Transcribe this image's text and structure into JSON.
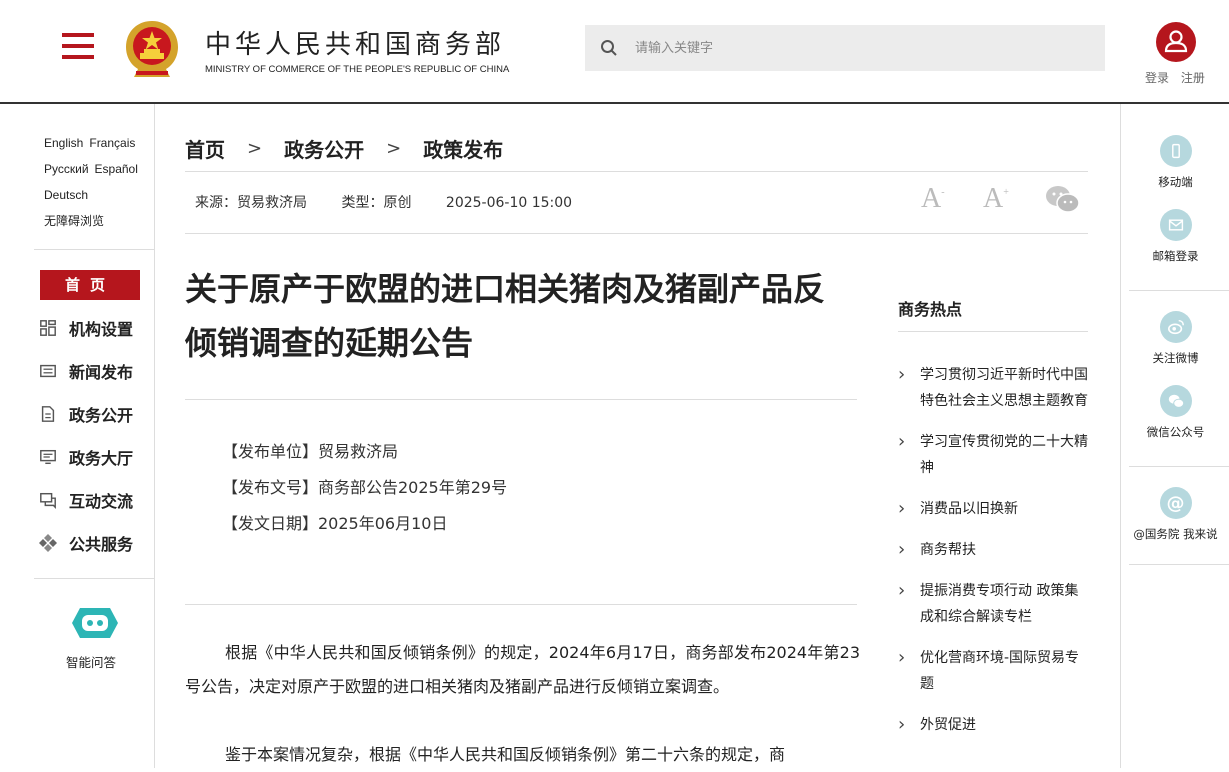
{
  "header": {
    "title": "中华人民共和国商务部",
    "subtitle": "MINISTRY OF COMMERCE OF THE PEOPLE'S REPUBLIC OF CHINA",
    "search_placeholder": "请输入关键字",
    "login": "登录",
    "register": "注册"
  },
  "languages": {
    "english": "English",
    "french": "Français",
    "russian": "Русский",
    "spanish": "Español",
    "german": "Deutsch",
    "accessibility": "无障碍浏览"
  },
  "nav": {
    "home": "首页",
    "items": [
      "机构设置",
      "新闻发布",
      "政务公开",
      "政务大厅",
      "互动交流",
      "公共服务"
    ],
    "robot_label": "智能问答"
  },
  "breadcrumb": [
    "首页",
    "政务公开",
    "政策发布"
  ],
  "meta": {
    "source": "来源：贸易救济局",
    "type": "类型：原创",
    "date": "2025-06-10 15:00"
  },
  "font_controls": [
    "A",
    "A"
  ],
  "article": {
    "title": "关于原产于欧盟的进口相关猪肉及猪副产品反倾销调查的延期公告",
    "info": [
      "【发布单位】贸易救济局",
      "【发布文号】商务部公告2025年第29号",
      "【发文日期】2025年06月10日"
    ],
    "paragraphs": [
      "根据《中华人民共和国反倾销条例》的规定，2024年6月17日，商务部发布2024年第23号公告，决定对原产于欧盟的进口相关猪肉及猪副产品进行反倾销立案调查。",
      "鉴于本案情况复杂，根据《中华人民共和国反倾销条例》第二十六条的规定，商"
    ]
  },
  "hot": {
    "title": "商务热点",
    "items": [
      "学习贯彻习近平新时代中国特色社会主义思想主题教育",
      "学习宣传贯彻党的二十大精神",
      "消费品以旧换新",
      "商务帮扶",
      "提振消费专项行动 政策集成和综合解读专栏",
      "优化营商环境-国际贸易专题",
      "外贸促进"
    ]
  },
  "right_bar": {
    "mobile": "移动端",
    "email": "邮箱登录",
    "weibo": "关注微博",
    "wechat": "微信公众号",
    "gov": "@国务院 我来说"
  },
  "colors": {
    "brand_red": "#b5161d",
    "icon_teal": "#b6d8de",
    "robot_teal": "#2db5b5"
  }
}
